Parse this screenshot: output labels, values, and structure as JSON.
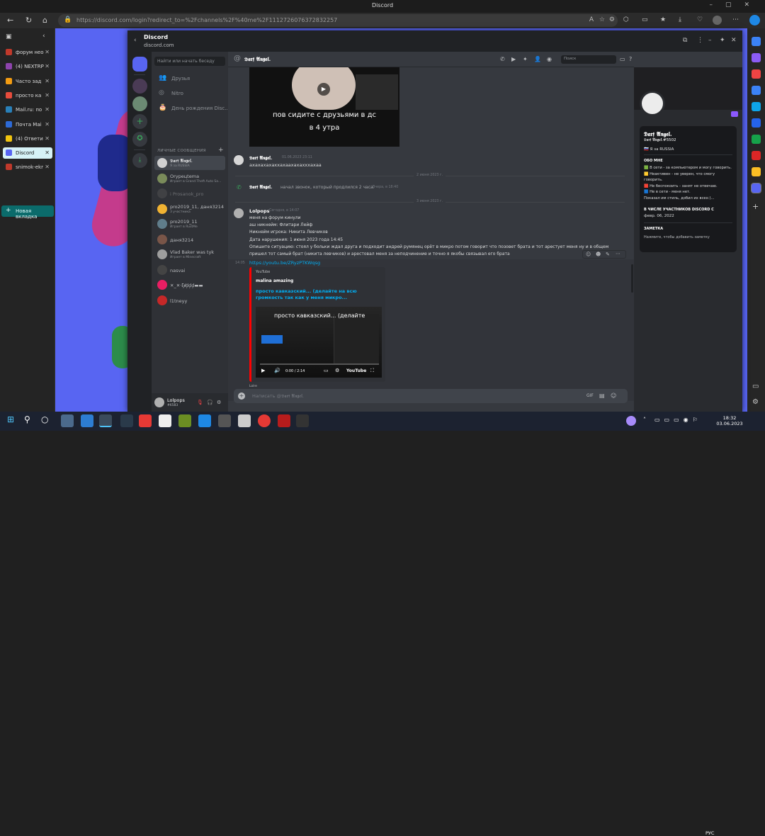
{
  "browser": {
    "window_title": "Discord",
    "url": "https://discord.com/login?redirect_to=%2Fchannels%2F%40me%2F1112726076372832257",
    "tabs": [
      {
        "label": "форум нео",
        "color": "#c0392b"
      },
      {
        "label": "(4) NEXTRP",
        "color": "#8e44ad"
      },
      {
        "label": "Часто зад",
        "color": "#f39c12"
      },
      {
        "label": "просто ка",
        "color": "#e74c3c"
      },
      {
        "label": "Mail.ru: по",
        "color": "#2980b9"
      },
      {
        "label": "Почта Mai",
        "color": "#2d6ad6"
      },
      {
        "label": "(4) Ответи",
        "color": "#f1c40f"
      },
      {
        "label": "Discord",
        "color": "#5865f2",
        "active": true
      },
      {
        "label": "snimok-ekr",
        "color": "#c0392b"
      }
    ],
    "new_tab_label": "Новая вкладка"
  },
  "discord": {
    "window_title": "Discord",
    "window_subtitle": "discord.com",
    "search_placeholder": "Найти или начать беседу",
    "nav": [
      {
        "label": "Друзья",
        "icon": "friends-icon"
      },
      {
        "label": "Nitro",
        "icon": "nitro-icon"
      },
      {
        "label": "День рождения Disc...",
        "icon": "birthday-icon"
      }
    ],
    "dm_header": "ЛИЧНЫЕ СООБЩЕНИЯ",
    "dms": [
      {
        "name": "𝕯𝖆𝖗𝖋 𝕬𝖓𝖌𝖊𝖑.",
        "sub": "Я за RUSSIA",
        "color": "#d0d0d0",
        "active": true
      },
      {
        "name": "Orypeцtema",
        "sub": "Играет в Grand Theft Auto Sa...",
        "color": "#7a8b5a"
      },
      {
        "name": "i Prosanok_pro",
        "sub": "",
        "color": "#555"
      },
      {
        "name": "pro2019_11, даня3214",
        "sub": "3 участника",
        "color": "#f0b232"
      },
      {
        "name": "pro2019_11",
        "sub": "Играет в RustMe",
        "color": "#607d8b"
      },
      {
        "name": "даня3214",
        "sub": "",
        "color": "#795548"
      },
      {
        "name": "Vlad Baker was tyk",
        "sub": "Играет в Minecraft",
        "color": "#9e9e9e"
      },
      {
        "name": "nasvai",
        "sub": "",
        "color": "#444"
      },
      {
        "name": "✕_✕·ξᵲ̸ḑḑḑ▬▬",
        "sub": "",
        "color": "#e91e63"
      },
      {
        "name": "l1tneyy",
        "sub": "",
        "color": "#c62828"
      }
    ],
    "user": {
      "name": "Lolpops",
      "tag": "#6583"
    },
    "chat": {
      "recipient": "𝕯𝖆𝖗𝖋 𝕬𝖓𝖌𝖊𝖑.",
      "search_label": "Поиск",
      "video_caption_1": "пов сидите с друзьями в дс",
      "video_caption_2": "в 4 утра",
      "msg1": {
        "author": "𝕯𝖆𝖗𝖋 𝕬𝖓𝖌𝖊𝖑.",
        "time": "01.06.2023 23:11",
        "text": "ахахахахаххахаахахахххахаа"
      },
      "divider1": "2 июня 2023 г.",
      "call": {
        "author": "𝕯𝖆𝖗𝖋 𝕬𝖓𝖌𝖊𝖑.",
        "text": "начал звонок, который продлился 2 часа.",
        "time": "Вчера, в 18:40"
      },
      "divider2": "3 июня 2023 г.",
      "msg2": {
        "author": "Lolpops",
        "time": "Сегодня, в 14:07",
        "lines": [
          "меня на форум кинули",
          "аш никнейм: Флитари Лейф",
          "Никнейм игрока: Никита Левчиков",
          "Дата нарушения: 1 июня 2023 года 14:45",
          "Опишите ситуацию: стоял у больки ждал друга и подходит андрей румянец орёт в микро потом говорит что позовет брата и тот арестует меня ну и в общем",
          "пришел тот самый брат (никита левчиков) и арестовал меня за неподчинение и точно я якобы связывал его брата"
        ],
        "hover_time": "14:05",
        "link": "https://youtu.be/ZRyzPTKWqsg"
      },
      "embed": {
        "provider": "YouTube",
        "author": "malina amazing",
        "title": "просто кавказский... (делайте на всю громкость так как у меня микро...",
        "video_title": "просто кавказский... (делайте",
        "time": "0:00 / 2:14",
        "yt_label": "YouTube"
      },
      "cut_text": "Lolre",
      "input_placeholder": "Написать @𝕯𝖆𝖗𝖋 𝕬𝖓𝖌𝖊𝖑."
    },
    "profile": {
      "name": "𝕯𝖆𝖗𝖋 𝕬𝖓𝖌𝖊𝖑.",
      "tag": "𝕯𝖆𝖗𝖋 𝕬𝖓𝖌𝖊𝖑.#5502",
      "status": "🇷🇺 Я за RUSSIA",
      "about_header": "ОБО МНЕ",
      "about_lines": [
        "🟩 В сети - за компьютером и могу говорить.",
        "🟨 Неактивен - не уверен, что смогу",
        "говорить.",
        "🟥 Не беспокоить - занят не отвечаю.",
        "🟦 Не в сети - меня нет.",
        "Показал им  стиль,  добил их всех:)..."
      ],
      "member_header": "В ЧИСЛЕ УЧАСТНИКОВ DISCORD С",
      "member_since": "февр. 06, 2022",
      "note_header": "ЗАМЕТКА",
      "note_placeholder": "Нажмите, чтобы добавить заметку"
    }
  },
  "taskbar": {
    "time": "18:32",
    "date": "03.06.2023",
    "lang": "РУС"
  }
}
